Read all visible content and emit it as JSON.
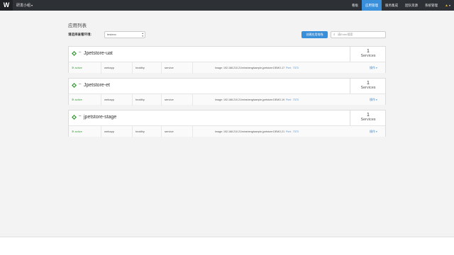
{
  "header": {
    "logo": "W",
    "team": "研发小组",
    "nav": [
      {
        "label": "看板",
        "active": false
      },
      {
        "label": "应用管理",
        "active": true
      },
      {
        "label": "服务集成",
        "active": false
      },
      {
        "label": "团队资源",
        "active": false
      },
      {
        "label": "系统管理",
        "active": false
      }
    ],
    "accent": "#3a8fdb"
  },
  "page": {
    "title": "应用列表",
    "filter_label": "请选择查看环境:",
    "env_value": "testenv",
    "create_button": "创建应用堆栈",
    "search_placeholder": "请Enter搜索"
  },
  "apps": [
    {
      "name": "Jpetstore-uat",
      "service_count": "1",
      "service_label": "Services",
      "service": {
        "status": "active",
        "type": "webapp",
        "health": "healthy",
        "kind": "service",
        "image_label": "Image:",
        "image": "192.168.210.21/minsheng/sample-jpetstore:DEMO-17",
        "port_label": "Port:",
        "port": "7373",
        "action": "操作"
      }
    },
    {
      "name": "Jpetstore-et",
      "service_count": "1",
      "service_label": "Services",
      "service": {
        "status": "active",
        "type": "webapp",
        "health": "healthy",
        "kind": "service",
        "image_label": "Image:",
        "image": "192.168.210.21/minsheng/sample-jpetstore:DEMO-19",
        "port_label": "Port:",
        "port": "7373",
        "action": "操作"
      }
    },
    {
      "name": "jpetstore-stage",
      "service_count": "1",
      "service_label": "Services",
      "service": {
        "status": "active",
        "type": "webapp",
        "health": "healthy",
        "kind": "service",
        "image_label": "Image:",
        "image": "192.168.210.21/minsheng/sample-jpetstore:DEMO-21",
        "port_label": "Port:",
        "port": "7373",
        "action": "操作"
      }
    }
  ]
}
